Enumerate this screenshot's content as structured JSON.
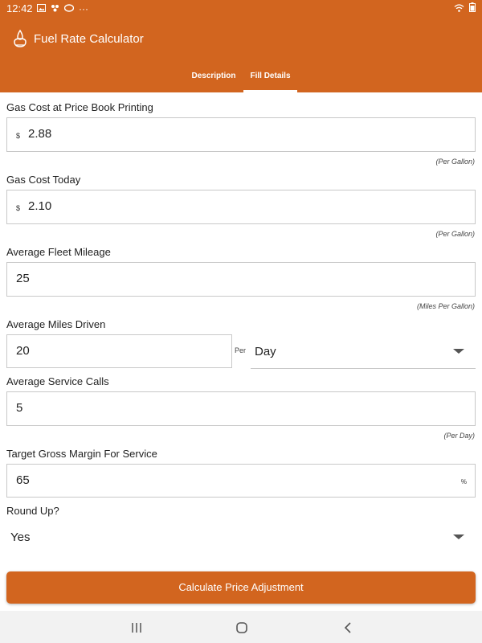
{
  "status_bar": {
    "time": "12:42",
    "overflow": "···"
  },
  "app": {
    "title": "Fuel Rate Calculator",
    "accent_color": "#d2651f"
  },
  "tabs": [
    {
      "label": "Description",
      "selected": false
    },
    {
      "label": "Fill Details",
      "selected": true
    }
  ],
  "fields": {
    "gas_cost_printing": {
      "label": "Gas Cost at Price Book Printing",
      "prefix": "$",
      "value": "2.88",
      "hint": "(Per Gallon)"
    },
    "gas_cost_today": {
      "label": "Gas Cost Today",
      "prefix": "$",
      "value": "2.10",
      "hint": "(Per Gallon)"
    },
    "fleet_mileage": {
      "label": "Average Fleet Mileage",
      "value": "25",
      "hint": "(Miles Per Gallon)"
    },
    "miles_driven": {
      "label": "Average Miles Driven",
      "value": "20",
      "per_label": "Per",
      "period": "Day"
    },
    "service_calls": {
      "label": "Average Service Calls",
      "value": "5",
      "hint": "(Per Day)"
    },
    "gross_margin": {
      "label": "Target Gross Margin For Service",
      "value": "65",
      "suffix": "%"
    },
    "round_up": {
      "label": "Round Up?",
      "value": "Yes"
    }
  },
  "button": {
    "label": "Calculate Price Adjustment"
  }
}
